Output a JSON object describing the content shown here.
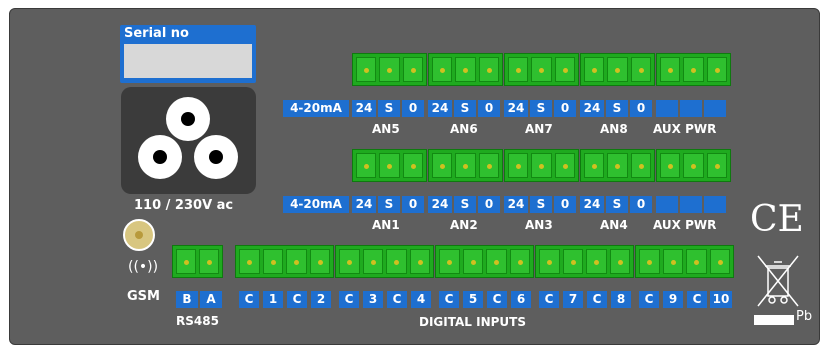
{
  "serial": {
    "label": "Serial no"
  },
  "power": {
    "voltage": "110 / 230V ac"
  },
  "gsm": {
    "signal": "((•))",
    "label": "GSM"
  },
  "rs485": {
    "pins": [
      "B",
      "A"
    ],
    "caption": "RS485"
  },
  "analog_top": {
    "mode": "4-20mA",
    "groups": [
      {
        "pins": [
          "24",
          "S",
          "0"
        ],
        "name": "AN5"
      },
      {
        "pins": [
          "24",
          "S",
          "0"
        ],
        "name": "AN6"
      },
      {
        "pins": [
          "24",
          "S",
          "0"
        ],
        "name": "AN7"
      },
      {
        "pins": [
          "24",
          "S",
          "0"
        ],
        "name": "AN8"
      }
    ],
    "aux": "AUX PWR"
  },
  "analog_bottom": {
    "mode": "4-20mA",
    "groups": [
      {
        "pins": [
          "24",
          "S",
          "0"
        ],
        "name": "AN1"
      },
      {
        "pins": [
          "24",
          "S",
          "0"
        ],
        "name": "AN2"
      },
      {
        "pins": [
          "24",
          "S",
          "0"
        ],
        "name": "AN3"
      },
      {
        "pins": [
          "24",
          "S",
          "0"
        ],
        "name": "AN4"
      }
    ],
    "aux": "AUX PWR"
  },
  "digital": {
    "pins": [
      "C",
      "1",
      "C",
      "2",
      "C",
      "3",
      "C",
      "4",
      "C",
      "5",
      "C",
      "6",
      "C",
      "7",
      "C",
      "8",
      "C",
      "9",
      "C",
      "10"
    ],
    "caption": "DIGITAL INPUTS"
  },
  "marks": {
    "ce": "CE",
    "pb": "Pb"
  },
  "colors": {
    "panel": "#5e5e5e",
    "label_blue": "#1e6fd0",
    "terminal_green": "#1faa1f"
  }
}
